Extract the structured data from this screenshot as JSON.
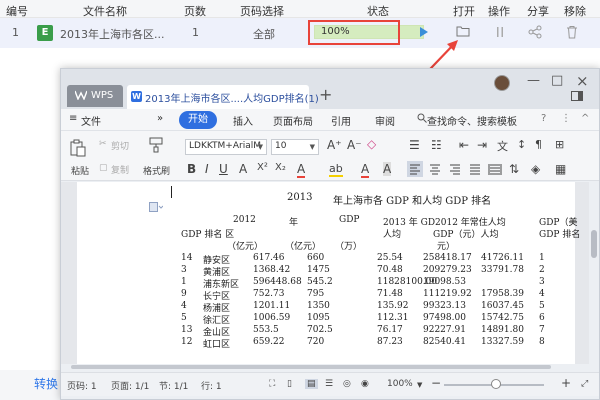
{
  "list": {
    "headers": [
      "编号",
      "文件名称",
      "页数",
      "页码选择",
      "状态",
      "打开",
      "操作",
      "分享",
      "移除"
    ],
    "row": {
      "index": "1",
      "file_badge": "E",
      "file_name": "2013年上海市各区...",
      "pages": "1",
      "page_select": "全部",
      "progress_label": "100%",
      "progress_value": 1.0
    },
    "convert_link": "转换"
  },
  "wps": {
    "tabs": [
      {
        "label": "WPS"
      },
      {
        "label": "2013年上海市各区....人均GDP排名(1)"
      }
    ],
    "tab_close": "×",
    "new_tab": "+",
    "window_controls": [
      "—",
      "□",
      "×"
    ],
    "ribbon_tabs": [
      "文件",
      "»",
      "开始",
      "插入",
      "页面布局",
      "引用",
      "审阅"
    ],
    "search_command": "查找命令、搜索模板",
    "toolbar": {
      "paste": "粘贴",
      "cut": "剪切",
      "copy": "复制",
      "format_painter": "格式刷",
      "font_name": "LDKKTM+ArialM",
      "font_size": "10"
    },
    "document": {
      "title_year": "2013",
      "title_rest": "年上海市各 GDP 和人均 GDP 排名",
      "header_line1": {
        "c1": "2012",
        "c2": "年",
        "c3": "GDP",
        "c4": "2013 年 GD2012 年常住人均",
        "c5": "GDP（美"
      },
      "header_line2": {
        "c0": "GDP 排名 区",
        "c4": "人均",
        "c5": "GDP（元）人均",
        "c6": "GDP 排名"
      },
      "header_line3": {
        "c1": "（亿元）",
        "c2": "（亿元）",
        "c3": "（万）",
        "c5": "元）"
      },
      "rows": [
        {
          "r1": "14",
          "district": "静安区",
          "v1": "617.46",
          "v2": "660",
          "v3": "25.54",
          "v4": "258418.17",
          "v5": "41726.11",
          "rank": "1"
        },
        {
          "r1": "3",
          "district": "黄浦区",
          "v1": "1368.42",
          "v2": "1475",
          "v3": "70.48",
          "v4": "209279.23",
          "v5": "33791.78",
          "rank": "2"
        },
        {
          "r1": "1",
          "district": "浦东新区",
          "v1": "596448.68",
          "v2": "545.2",
          "v3": "11828100.00",
          "v4": "19098.53",
          "v5": "",
          "rank": "3"
        },
        {
          "r1": "9",
          "district": "长宁区",
          "v1": "752.73",
          "v2": "795",
          "v3": "71.48",
          "v4": "111219.92",
          "v5": "17958.39",
          "rank": "4"
        },
        {
          "r1": "4",
          "district": "杨浦区",
          "v1": "1201.11",
          "v2": "1350",
          "v3": "135.92",
          "v4": "99323.13",
          "v5": "16037.45",
          "rank": "5"
        },
        {
          "r1": "5",
          "district": "徐汇区",
          "v1": "1006.59",
          "v2": "1095",
          "v3": "112.31",
          "v4": "97498.00",
          "v5": "15742.75",
          "rank": "6"
        },
        {
          "r1": "13",
          "district": "金山区",
          "v1": "553.5",
          "v2": "702.5",
          "v3": "76.17",
          "v4": "92227.91",
          "v5": "14891.80",
          "rank": "7"
        },
        {
          "r1": "12",
          "district": "虹口区",
          "v1": "659.22",
          "v2": "720",
          "v3": "87.23",
          "v4": "82540.41",
          "v5": "13327.59",
          "rank": "8"
        }
      ]
    },
    "status": {
      "page_code": "页码: 1",
      "page": "页面: 1/1",
      "section": "节: 1/1",
      "line": "行: 1",
      "zoom": "100%",
      "zoom_minus": "−",
      "zoom_plus": "+"
    }
  },
  "colors": {
    "accent_blue": "#2f6fe0",
    "highlight_red": "#e8433a",
    "excel_green": "#3a9d4a"
  }
}
